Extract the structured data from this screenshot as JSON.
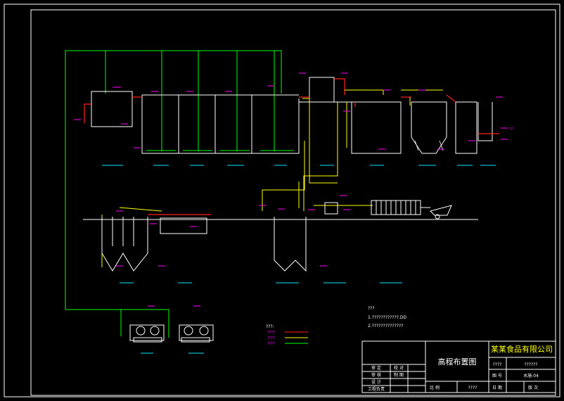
{
  "colors": {
    "background": "#000000",
    "frame": "#ffffff",
    "air_line": "#00ff00",
    "sludge_line": "#ffff00",
    "water_line": "#ff2020",
    "label": "#00e5ff",
    "tag": "#ff00ff"
  },
  "notes": {
    "heading": "???",
    "line1": "1.????????????.DD",
    "line2": "2.??????????????"
  },
  "legend": {
    "title": "???:",
    "items": [
      {
        "label": "????",
        "color": "#ff2020"
      },
      {
        "label": "????",
        "color": "#ffff00"
      },
      {
        "label": "????",
        "color": "#00ff00"
      }
    ]
  },
  "outlet_label": "??",
  "title_block": {
    "company": "某某食品有限公司",
    "drawing_title": "高程布置图",
    "project_label": "????",
    "project_value": "??????",
    "drawing_no_label": "图 号",
    "drawing_no_value": "水施-04",
    "row_labels": [
      "审 定",
      "审 核",
      "设 计",
      "工程负责"
    ],
    "row_right": [
      "校 对",
      "制 图"
    ],
    "bottom_left": "比 例",
    "bottom_mid": "????",
    "bottom_date_label": "日 期",
    "bottom_ver_label": "版 次"
  }
}
